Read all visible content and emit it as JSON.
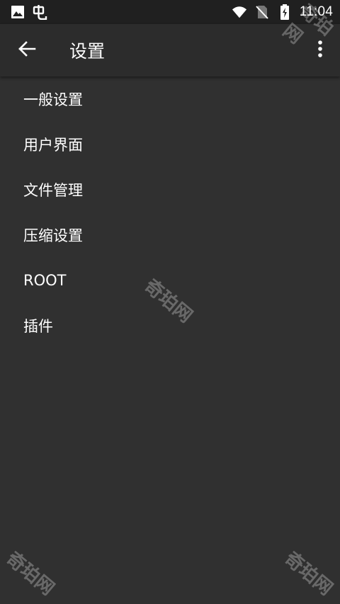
{
  "status_bar": {
    "time": "11:04",
    "left_icons": [
      "image-icon",
      "debug-icon"
    ],
    "right_icons": [
      "wifi-icon",
      "no-sim-icon",
      "battery-charging-icon"
    ]
  },
  "app_bar": {
    "title": "设置",
    "back_icon": "arrow-back-icon",
    "more_icon": "more-vert-icon"
  },
  "settings": {
    "items": [
      {
        "label": "一般设置"
      },
      {
        "label": "用户界面"
      },
      {
        "label": "文件管理"
      },
      {
        "label": "压缩设置"
      },
      {
        "label": "ROOT"
      },
      {
        "label": "插件"
      }
    ]
  },
  "watermark": {
    "text": "奇珀网"
  },
  "colors": {
    "background": "#303030",
    "app_bar": "#2c2c2c",
    "status_bar": "#202020",
    "text": "#ffffff"
  }
}
